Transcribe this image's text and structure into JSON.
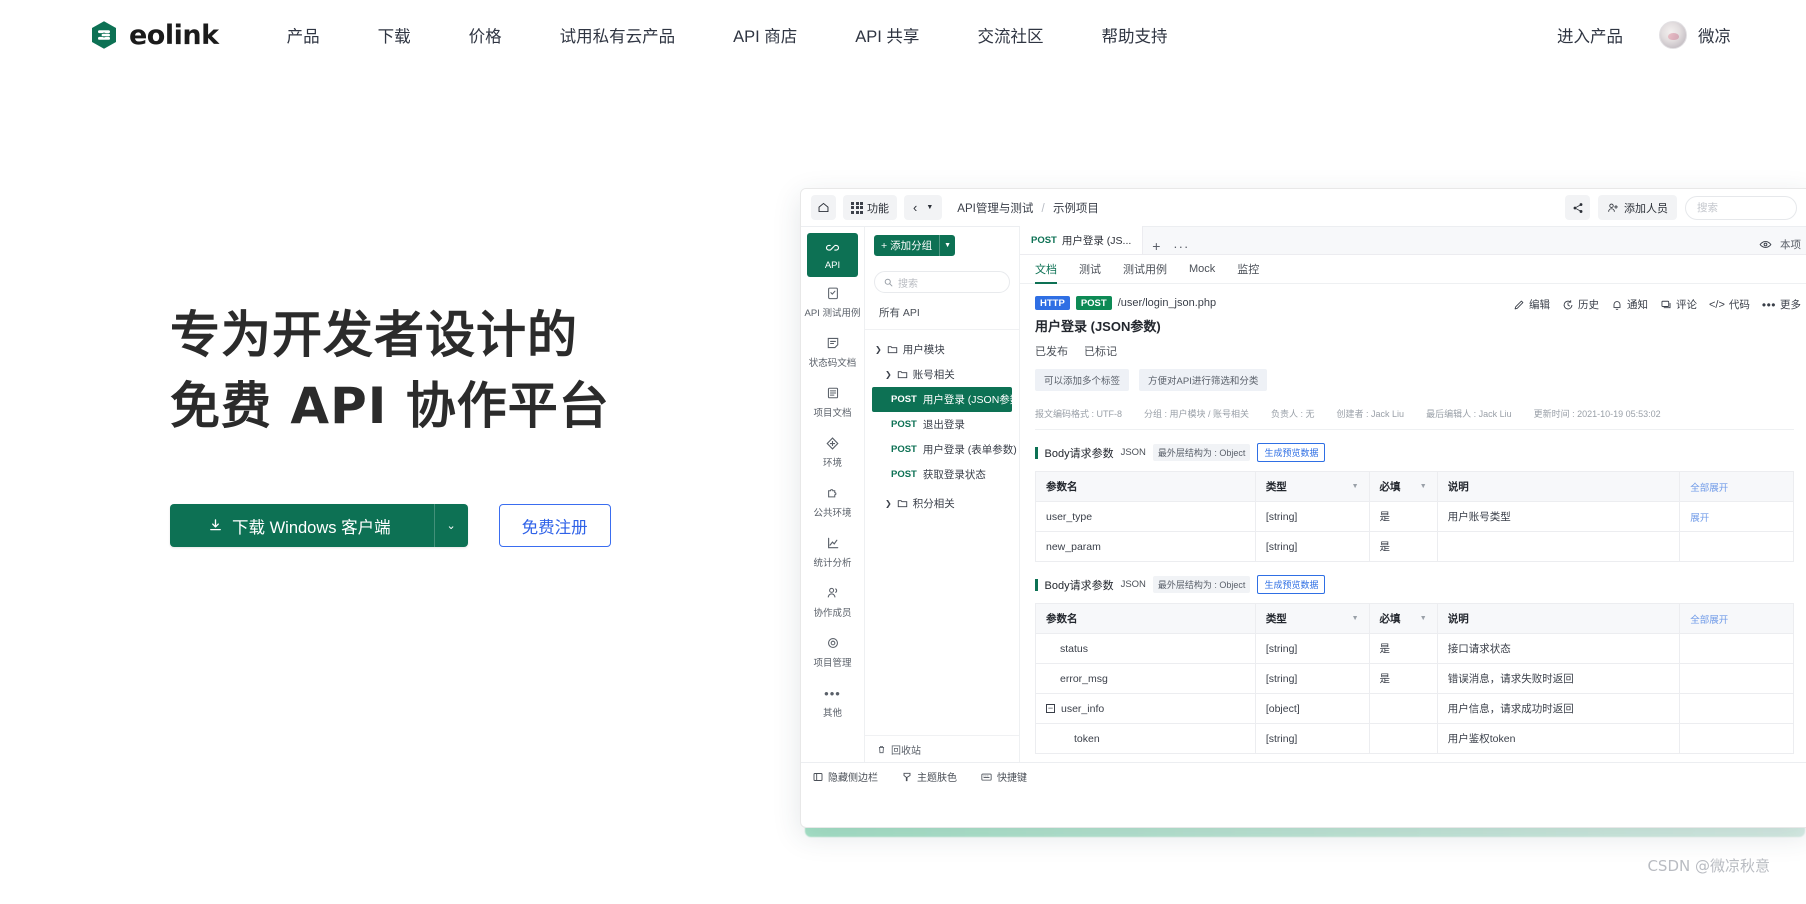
{
  "topnav": {
    "logo_text": "eolink",
    "links": [
      "产品",
      "下载",
      "价格",
      "试用私有云产品",
      "API 商店",
      "API 共享",
      "交流社区",
      "帮助支持"
    ],
    "enter_product": "进入产品",
    "username": "微凉"
  },
  "hero": {
    "line1": "专为开发者设计的",
    "line2": "免费 API 协作平台",
    "download_label": "下载 Windows 客户端",
    "download_caret": "⌄",
    "register_label": "免费注册"
  },
  "app": {
    "toolbar": {
      "home_icon": "home-icon",
      "function_label": "功能",
      "back_icon": "‹",
      "caret_icon": "▼",
      "breadcrumb_root": "API管理与测试",
      "breadcrumb_sep": "/",
      "breadcrumb_leaf": "示例项目",
      "share_icon": "share-icon",
      "add_member_label": "添加人员",
      "search_placeholder": "搜索"
    },
    "rail": [
      {
        "label": "API",
        "icon": "link-icon",
        "active": true
      },
      {
        "label": "API 测试用例",
        "icon": "clipboard-check-icon",
        "active": false
      },
      {
        "label": "状态码文档",
        "icon": "note-icon",
        "active": false
      },
      {
        "label": "项目文档",
        "icon": "book-icon",
        "active": false
      },
      {
        "label": "环境",
        "icon": "cube-icon",
        "active": false
      },
      {
        "label": "公共环境",
        "icon": "puzzle-icon",
        "active": false
      },
      {
        "label": "统计分析",
        "icon": "chart-icon",
        "active": false
      },
      {
        "label": "协作成员",
        "icon": "users-icon",
        "active": false
      },
      {
        "label": "项目管理",
        "icon": "gear-icon",
        "active": false
      },
      {
        "label": "其他",
        "icon": "ellipsis-icon",
        "active": false
      }
    ],
    "tree": {
      "add_group_label": "添加分组",
      "add_group_caret": "▼",
      "search_placeholder": "搜索",
      "all_api_label": "所有 API",
      "nodes": [
        {
          "type": "folder",
          "level": 1,
          "label": "用户模块"
        },
        {
          "type": "folder",
          "level": 2,
          "label": "账号相关"
        },
        {
          "type": "api",
          "verb": "POST",
          "label": "用户登录 (JSON参数)",
          "selected": true
        },
        {
          "type": "api",
          "verb": "POST",
          "label": "退出登录",
          "selected": false
        },
        {
          "type": "api",
          "verb": "POST",
          "label": "用户登录 (表单参数)",
          "selected": false
        },
        {
          "type": "api",
          "verb": "POST",
          "label": "获取登录状态",
          "selected": false
        },
        {
          "type": "folder",
          "level": 1,
          "label": "积分相关"
        }
      ],
      "recycle_bin": "回收站"
    },
    "doc": {
      "tab_verb": "POST",
      "tab_label": "用户登录 (JS...",
      "tab_plus": "+",
      "tab_dots": "···",
      "eye_icon": "eye-icon",
      "tab_right_label": "本项",
      "subtabs": [
        {
          "label": "文档",
          "active": true
        },
        {
          "label": "测试",
          "active": false
        },
        {
          "label": "测试用例",
          "active": false
        },
        {
          "label": "Mock",
          "active": false
        },
        {
          "label": "监控",
          "active": false
        }
      ],
      "protocol_badge": "HTTP",
      "method_badge": "POST",
      "url": "/user/login_json.php",
      "title": "用户登录 (JSON参数)",
      "status": [
        "已发布",
        "已标记"
      ],
      "tags": [
        "可以添加多个标签",
        "方便对API进行筛选和分类"
      ],
      "actions": [
        {
          "label": "编辑",
          "icon": "pencil-icon"
        },
        {
          "label": "历史",
          "icon": "history-icon"
        },
        {
          "label": "通知",
          "icon": "bell-icon"
        },
        {
          "label": "评论",
          "icon": "comment-icon"
        },
        {
          "label": "代码",
          "icon": "code-icon"
        },
        {
          "label": "更多",
          "icon": "ellipsis-icon"
        }
      ],
      "meta": [
        "报文编码格式 : UTF-8",
        "分组 : 用户模块 / 账号相关",
        "负责人 : 无",
        "创建者 : Jack Liu",
        "最后编辑人 : Jack Liu",
        "更新时间 : 2021-10-19 05:53:02"
      ],
      "sections": [
        {
          "title": "Body请求参数",
          "kind": "JSON",
          "chip": "最外层结构为 : Object",
          "button": "生成预览数据",
          "columns": [
            "参数名",
            "类型",
            "必填",
            "说明"
          ],
          "expand_all": "全部展开",
          "rows": [
            {
              "name": "user_type",
              "indent": 0,
              "type": "[string]",
              "required": "是",
              "desc": "用户账号类型",
              "action": "展开"
            },
            {
              "name": "new_param",
              "indent": 0,
              "type": "[string]",
              "required": "是",
              "desc": "",
              "action": ""
            }
          ]
        },
        {
          "title": "Body请求参数",
          "kind": "JSON",
          "chip": "最外层结构为 : Object",
          "button": "生成预览数据",
          "columns": [
            "参数名",
            "类型",
            "必填",
            "说明"
          ],
          "expand_all": "全部展开",
          "rows": [
            {
              "name": "status",
              "indent": 1,
              "type": "[string]",
              "required": "是",
              "desc": "接口请求状态",
              "action": ""
            },
            {
              "name": "error_msg",
              "indent": 1,
              "type": "[string]",
              "required": "是",
              "desc": "错误消息，请求失败时返回",
              "action": ""
            },
            {
              "name": "user_info",
              "indent": 1,
              "collapse": "−",
              "type": "[object]",
              "required": "",
              "desc": "用户信息，请求成功时返回",
              "action": ""
            },
            {
              "name": "token",
              "indent": 2,
              "type": "[string]",
              "required": "",
              "desc": "用户鉴权token",
              "action": ""
            }
          ]
        }
      ]
    },
    "bottombar": [
      {
        "label": "隐藏侧边栏",
        "icon": "panel-icon"
      },
      {
        "label": "主题肤色",
        "icon": "palette-icon"
      },
      {
        "label": "快捷键",
        "icon": "keyboard-icon"
      }
    ]
  },
  "watermark": "CSDN @微凉秋意",
  "colors": {
    "brand_green": "#0d7154",
    "accent_blue": "#2f62e8",
    "http_blue": "#2f6fe4"
  }
}
